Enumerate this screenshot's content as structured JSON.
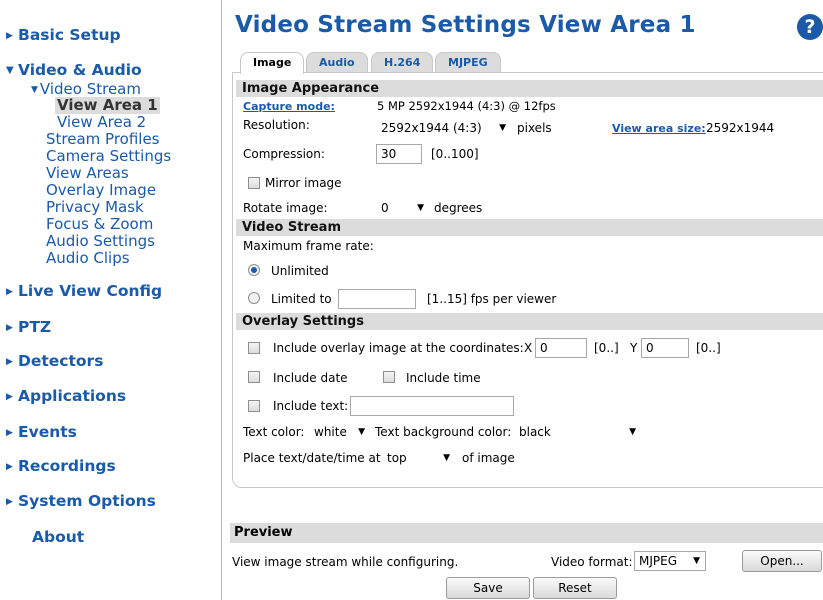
{
  "sidebar": {
    "basic_setup": "Basic Setup",
    "video_audio": "Video & Audio",
    "video_stream": "Video Stream",
    "view_area_1": "View Area 1",
    "view_area_2": "View Area 2",
    "stream_profiles": "Stream Profiles",
    "camera_settings": "Camera Settings",
    "view_areas": "View Areas",
    "overlay_image": "Overlay Image",
    "privacy_mask": "Privacy Mask",
    "focus_zoom": "Focus & Zoom",
    "audio_settings": "Audio Settings",
    "audio_clips": "Audio Clips",
    "live_view_config": "Live View Config",
    "ptz": "PTZ",
    "detectors": "Detectors",
    "applications": "Applications",
    "events": "Events",
    "recordings": "Recordings",
    "system_options": "System Options",
    "about": "About"
  },
  "header": {
    "title": "Video Stream Settings View Area 1",
    "help": "?"
  },
  "tabs": [
    "Image",
    "Audio",
    "H.264",
    "MJPEG"
  ],
  "image_appearance": {
    "heading": "Image Appearance",
    "capture_mode_label": "Capture mode:",
    "capture_mode_value": "5 MP 2592x1944 (4:3) @ 12fps",
    "resolution_label": "Resolution:",
    "resolution_value": "2592x1944 (4:3)",
    "resolution_unit": "pixels",
    "view_area_size_label": "View area size:",
    "view_area_size_value": "2592x1944",
    "compression_label": "Compression:",
    "compression_value": "30",
    "compression_range": "[0..100]",
    "mirror_label": "Mirror image",
    "rotate_label": "Rotate image:",
    "rotate_value": "0",
    "rotate_unit": "degrees"
  },
  "video_stream": {
    "heading": "Video Stream",
    "max_frame_rate_label": "Maximum frame rate:",
    "unlimited_label": "Unlimited",
    "limited_label": "Limited to",
    "limited_value": "",
    "limited_range": "[1..15] fps per viewer"
  },
  "overlay": {
    "heading": "Overlay Settings",
    "include_overlay_label": "Include overlay image at the coordinates:",
    "x_label": "X",
    "x_value": "0",
    "x_range": "[0..]",
    "y_label": "Y",
    "y_value": "0",
    "y_range": "[0..]",
    "include_date_label": "Include date",
    "include_time_label": "Include time",
    "include_text_label": "Include text:",
    "include_text_value": "",
    "text_color_label": "Text color:",
    "text_color_value": "white",
    "text_bg_label": "Text background color:",
    "text_bg_value": "black",
    "place_label": "Place text/date/time at",
    "place_value": "top",
    "place_suffix": "of image"
  },
  "preview": {
    "heading": "Preview",
    "description": "View image stream while configuring.",
    "video_format_label": "Video format:",
    "video_format_value": "MJPEG",
    "open_button": "Open..."
  },
  "actions": {
    "save": "Save",
    "reset": "Reset"
  },
  "colors": {
    "link": "#1a5aa8",
    "section_bg": "#dcdcdc"
  }
}
